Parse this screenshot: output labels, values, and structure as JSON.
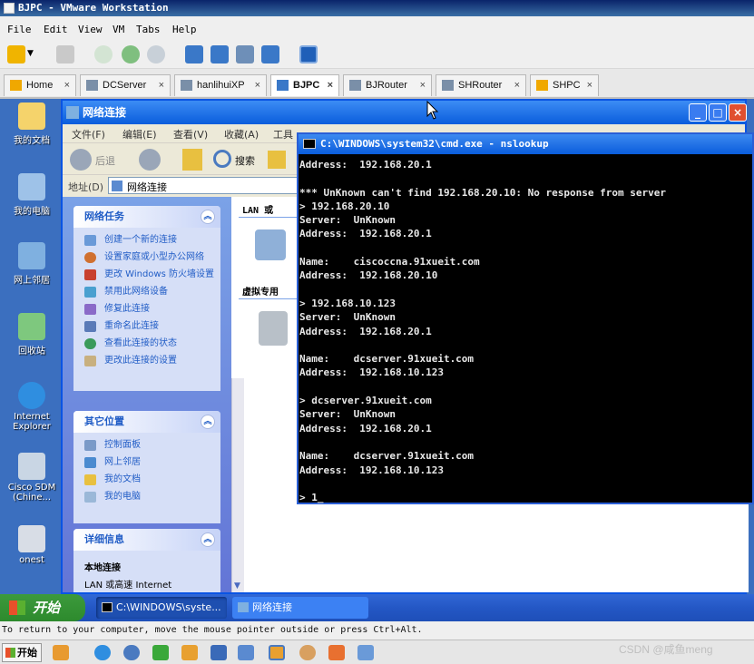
{
  "vmware": {
    "title": "BJPC - VMware Workstation",
    "menu": [
      "File",
      "Edit",
      "View",
      "VM",
      "Tabs",
      "Help"
    ],
    "tabs": [
      {
        "label": "Home"
      },
      {
        "label": "DCServer"
      },
      {
        "label": "hanlihuiXP"
      },
      {
        "label": "BJPC"
      },
      {
        "label": "BJRouter"
      },
      {
        "label": "SHRouter"
      },
      {
        "label": "SHPC"
      }
    ],
    "status_text": "To return to your computer, move the mouse pointer outside or press Ctrl+Alt."
  },
  "desktop": {
    "icons": [
      {
        "label": "我的文档"
      },
      {
        "label": "我的电脑"
      },
      {
        "label": "网上邻居"
      },
      {
        "label": "回收站"
      },
      {
        "label": "Internet Explorer"
      },
      {
        "label": "Cisco SDM (Chine..."
      },
      {
        "label": "onest"
      }
    ]
  },
  "netwin": {
    "title": "网络连接",
    "menu": [
      "文件(F)",
      "编辑(E)",
      "查看(V)",
      "收藏(A)",
      "工具"
    ],
    "back_label": "后退",
    "search_label": "搜索",
    "address_label": "地址(D)",
    "address_value": "网络连接",
    "content_header": "LAN 或",
    "vpn_header": "虚拟专用",
    "panels": {
      "tasks": {
        "title": "网络任务",
        "items": [
          "创建一个新的连接",
          "设置家庭或小型办公网络",
          "更改 Windows 防火墙设置",
          "禁用此网络设备",
          "修复此连接",
          "重命名此连接",
          "查看此连接的状态",
          "更改此连接的设置"
        ]
      },
      "places": {
        "title": "其它位置",
        "items": [
          "控制面板",
          "网上邻居",
          "我的文档",
          "我的电脑"
        ]
      },
      "details": {
        "title": "详细信息",
        "name": "本地连接",
        "desc": "LAN 或高速 Internet"
      }
    }
  },
  "cmd": {
    "title": "C:\\WINDOWS\\system32\\cmd.exe - nslookup",
    "lines": [
      "Address:  192.168.20.1",
      "",
      "*** UnKnown can't find 192.168.20.10: No response from server",
      "> 192.168.20.10",
      "Server:  UnKnown",
      "Address:  192.168.20.1",
      "",
      "Name:    ciscoccna.91xueit.com",
      "Address:  192.168.20.10",
      "",
      "> 192.168.10.123",
      "Server:  UnKnown",
      "Address:  192.168.20.1",
      "",
      "Name:    dcserver.91xueit.com",
      "Address:  192.168.10.123",
      "",
      "> dcserver.91xueit.com",
      "Server:  UnKnown",
      "Address:  192.168.20.1",
      "",
      "Name:    dcserver.91xueit.com",
      "Address:  192.168.10.123",
      "",
      "> 1_"
    ]
  },
  "xp_taskbar": {
    "start_label": "开始",
    "tasks": [
      "C:\\WINDOWS\\syste...",
      "网络连接"
    ]
  },
  "host_taskbar": {
    "start_label": "开始"
  },
  "watermark": "CSDN @咸鱼meng",
  "colors": {
    "xp_title_blue": "#0a5ddc",
    "desktop_blue": "#3b6fbf",
    "sidebar_blue": "#6f8fe0",
    "link_blue": "#215dc6",
    "xp_start_green": "#3c9a3c"
  }
}
